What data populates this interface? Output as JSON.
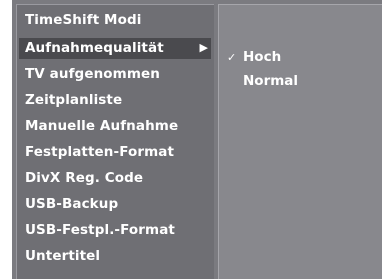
{
  "menu": {
    "items": [
      {
        "label": "TimeShift Modi"
      },
      {
        "label": "Aufnahmequalität",
        "has_submenu": true
      },
      {
        "label": "TV aufgenommen"
      },
      {
        "label": "Zeitplanliste"
      },
      {
        "label": "Manuelle Aufnahme"
      },
      {
        "label": "Festplatten-Format"
      },
      {
        "label": "DivX Reg. Code"
      },
      {
        "label": "USB-Backup"
      },
      {
        "label": "USB-Festpl.-Format"
      },
      {
        "label": "Untertitel"
      }
    ],
    "arrow_glyph": "▶"
  },
  "submenu": {
    "check_glyph": "✓",
    "options": [
      {
        "label": "Hoch",
        "checked": true
      },
      {
        "label": "Normal",
        "checked": false
      }
    ]
  }
}
